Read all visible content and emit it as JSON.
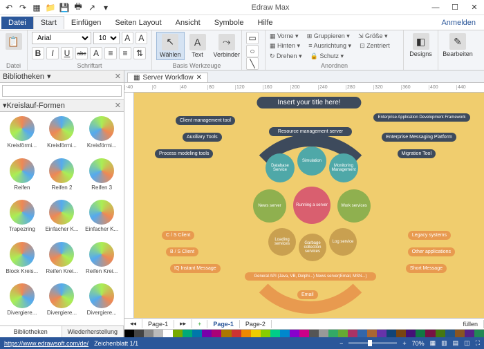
{
  "app": {
    "title": "Edraw Max"
  },
  "qat": {
    "undo": "↶",
    "redo": "↷",
    "new": "▦",
    "open": "📁",
    "save": "💾",
    "print": "🖶",
    "export": "↗",
    "more": "▾"
  },
  "win": {
    "min": "—",
    "max": "☐",
    "close": "✕"
  },
  "menu": {
    "file": "Datei",
    "start": "Start",
    "insert": "Einfügen",
    "layout": "Seiten Layout",
    "view": "Ansicht",
    "symbols": "Symbole",
    "help": "Hilfe",
    "login": "Anmelden"
  },
  "ribbon": {
    "file_group": "Datei",
    "font_group": "Schriftart",
    "tools_group": "Basis Werkzeuge",
    "arrange_group": "Anordnen",
    "font_name": "Arial",
    "font_size": "10",
    "bold": "B",
    "italic": "I",
    "underline": "U",
    "strike": "abc",
    "select": "Wählen",
    "text": "Text",
    "connector": "Verbinder",
    "front": "Vorne",
    "back": "Hinten",
    "rotate": "Drehen",
    "group": "Gruppieren",
    "align": "Ausrichtung",
    "protect": "Schutz",
    "size": "Größe",
    "center": "Zentriert",
    "designs": "Designs",
    "edit": "Bearbeiten"
  },
  "library": {
    "title": "Bibliotheken",
    "section": "Kreislauf-Formen",
    "search_ph": "",
    "shapes": [
      "Kreisförmi...",
      "Kreisförmi...",
      "Kreisförmi...",
      "Reifen",
      "Reifen 2",
      "Reifen 3",
      "Trapezring",
      "Einfacher K...",
      "Einfacher K...",
      "Block Kreis...",
      "Reifen Krei...",
      "Reifen Krei...",
      "Divergiere...",
      "Divergiere...",
      "Divergiere..."
    ],
    "tab1": "Bibliotheken",
    "tab2": "Wiederherstellung"
  },
  "doc": {
    "tab": "Server Workflow"
  },
  "ruler": [
    "-40",
    "0",
    "40",
    "80",
    "120",
    "160",
    "200",
    "240",
    "280",
    "320",
    "360",
    "400",
    "440"
  ],
  "diagram": {
    "title": "Insert your title here!",
    "left_pills": [
      "Client management tool",
      "Auxiliary Tools",
      "Process modeling tools"
    ],
    "right_pills": [
      "Enterprise Application Development Framework",
      "Enterprise Messaging Platform",
      "Migration Tool"
    ],
    "center_top": "Resource management server",
    "top_circles": [
      "Database Service",
      "Simulation",
      "Monitoring Management"
    ],
    "mid_circles": [
      "News server",
      "Running a server",
      "Work services"
    ],
    "bot_circles": [
      "Loading services",
      "Garbage collection services",
      "Log service"
    ],
    "ol1": "C / S Client",
    "ol2": "B / S Client",
    "ol3": "IQ Instant Message",
    "or1": "Legacy systems",
    "or2": "Other applications",
    "or3": "Short Message",
    "ob1": "General API (Java, VB, Delphi...) News server(Email, MSN...)",
    "ob2": "Email"
  },
  "pages": {
    "fill": "füllen",
    "p1": "Page-1",
    "p2": "Page-1",
    "p3": "Page-2"
  },
  "status": {
    "url": "https://www.edrawsoft.com/de/",
    "sheet": "Zeichenblatt 1/1",
    "zminus": "−",
    "zplus": "+",
    "zoom": "70%"
  },
  "colors": [
    "#000",
    "#444",
    "#888",
    "#bbb",
    "#fff",
    "#7a0",
    "#0a7",
    "#07a",
    "#70a",
    "#a07",
    "#a70",
    "#c33",
    "#e80",
    "#ec0",
    "#8c0",
    "#0c8",
    "#08c",
    "#80c",
    "#c08",
    "#555",
    "#999",
    "#3a6",
    "#6a3",
    "#a36",
    "#36a",
    "#a63",
    "#63a",
    "#147",
    "#741",
    "#417",
    "#174",
    "#714",
    "#471",
    "#258",
    "#852",
    "#528",
    "#285"
  ]
}
